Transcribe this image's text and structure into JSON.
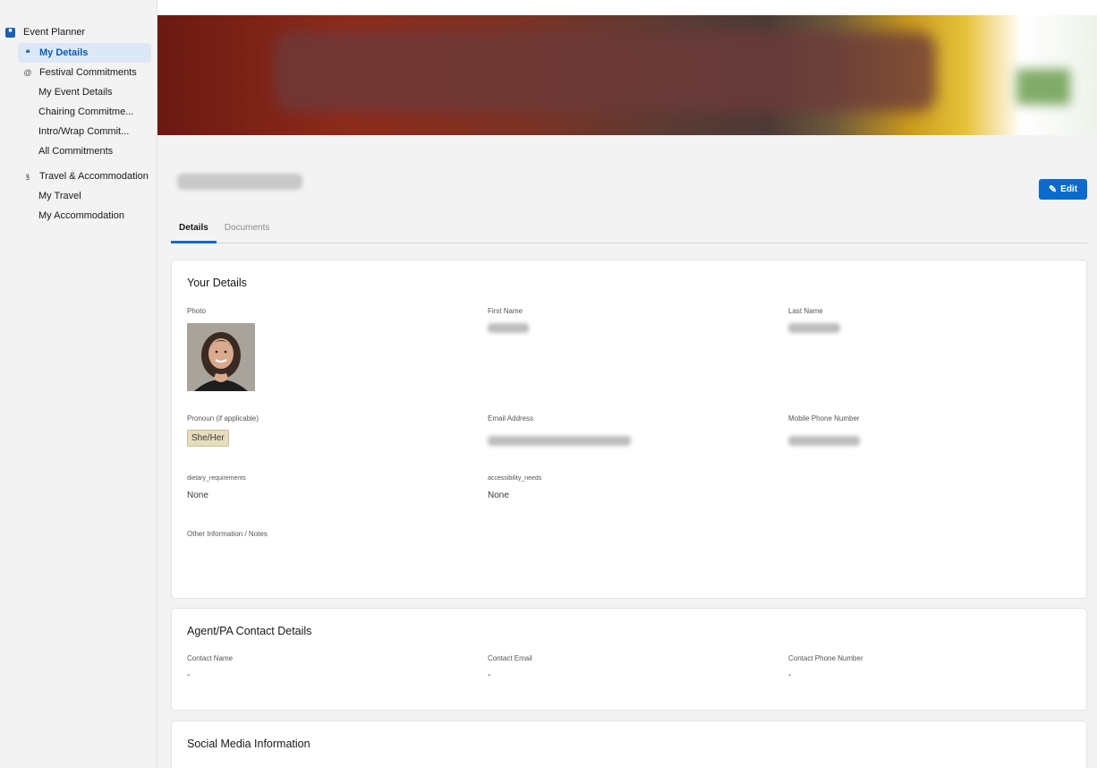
{
  "sidebar": {
    "app_title": "Event Planner",
    "items": [
      {
        "label": "My Details",
        "active": true,
        "icon": "quote-icon"
      },
      {
        "label": "Festival Commitments",
        "icon": "at-icon"
      },
      {
        "label": "My Event Details"
      },
      {
        "label": "Chairing Commitme..."
      },
      {
        "label": "Intro/Wrap Commit..."
      },
      {
        "label": "All Commitments"
      },
      {
        "label": "Travel & Accommodation",
        "icon": "bicycle-icon"
      },
      {
        "label": "My Travel"
      },
      {
        "label": "My Accommodation"
      }
    ]
  },
  "header": {
    "edit_label": "Edit"
  },
  "tabs": [
    {
      "label": "Details",
      "active": true
    },
    {
      "label": "Documents",
      "active": false
    }
  ],
  "your_details": {
    "title": "Your Details",
    "photo_label": "Photo",
    "first_name_label": "First Name",
    "last_name_label": "Last Name",
    "pronoun_label": "Pronoun (if applicable)",
    "pronoun_value": "She/Her",
    "email_label": "Email Address",
    "mobile_label": "Mobile Phone Number",
    "dietary_label": "dietary_requirements",
    "dietary_value": "None",
    "accessibility_label": "accessibility_needs",
    "accessibility_value": "None",
    "notes_label": "Other Information / Notes"
  },
  "agent_contact": {
    "title": "Agent/PA Contact Details",
    "name_label": "Contact Name",
    "name_value": "-",
    "email_label": "Contact Email",
    "email_value": "-",
    "phone_label": "Contact Phone Number",
    "phone_value": "-"
  },
  "social_media": {
    "title": "Social Media Information"
  },
  "colors": {
    "accent": "#0b6bcb",
    "active_nav_bg": "#dde8f6",
    "page_bg": "#f3f3f3"
  }
}
